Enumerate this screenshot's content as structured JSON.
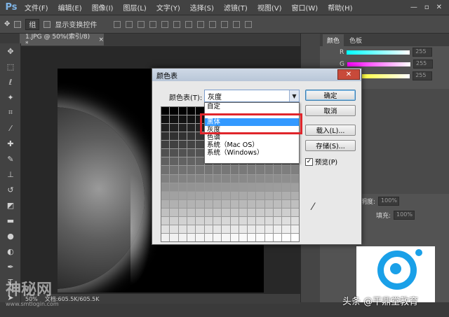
{
  "app": {
    "logo": "Ps"
  },
  "menubar": {
    "items": [
      "文件(F)",
      "编辑(E)",
      "图像(I)",
      "图层(L)",
      "文字(Y)",
      "选择(S)",
      "滤镜(T)",
      "视图(V)",
      "窗口(W)",
      "帮助(H)"
    ]
  },
  "window_controls": {
    "minimize": "—",
    "restore": "▫",
    "close": "✕"
  },
  "options_bar": {
    "align_label": "组",
    "transform_label": "显示变换控件"
  },
  "document": {
    "tab_label": "1.JPG @ 50%(索引/8) *",
    "tab_close": "×"
  },
  "status": {
    "zoom": "50%",
    "doc_info": "文档:605.5K/605.5K"
  },
  "panels": {
    "color_tab": "颜色",
    "swatches_tab": "色板",
    "slider_labels": [
      "R",
      "G",
      "B"
    ],
    "slider_values": [
      "255",
      "255",
      "255"
    ],
    "opacity_label": "不透明度:",
    "opacity_value": "100%",
    "fill_label": "填充:",
    "fill_value": "100%"
  },
  "dialog": {
    "title": "颜色表",
    "close_symbol": "✕",
    "table_label": "颜色表(T):",
    "table_value": "灰度",
    "dropdown_options": [
      "自定",
      "",
      "黑体",
      "灰度",
      "色谱",
      "系统（Mac OS）",
      "系统（Windows）"
    ],
    "selected_index": 2,
    "buttons": {
      "ok": "确定",
      "cancel": "取消",
      "load": "载入(L)...",
      "save": "存储(S)..."
    },
    "preview_label": "预览(P)",
    "preview_checked": "✓"
  },
  "watermarks": {
    "left_text": "神秘网",
    "left_url": "www.smtlogin.com",
    "bottom_right": "头条 @平鼎堂教育"
  },
  "colors": {
    "accent_red": "#e0252b",
    "selection_blue": "#3399ff",
    "logo_blue": "#1aa0e8"
  }
}
